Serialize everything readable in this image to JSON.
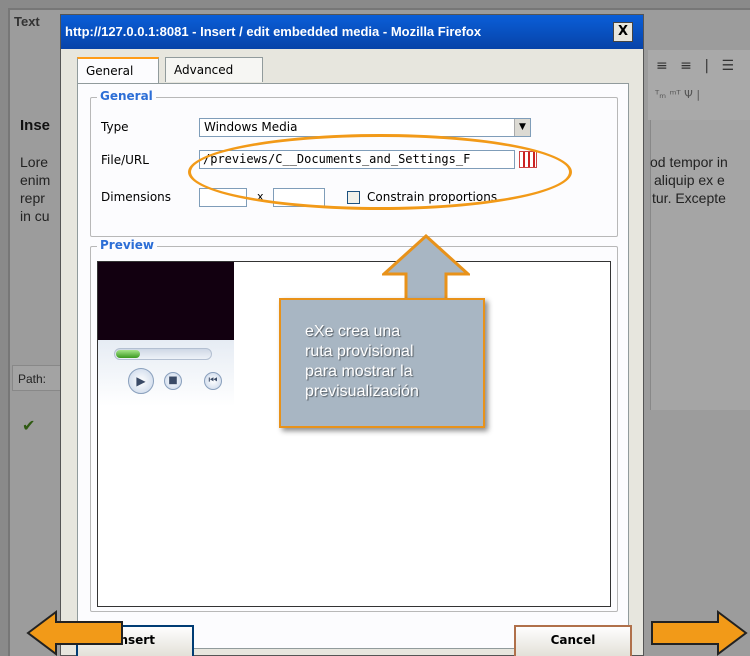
{
  "background_app": {
    "title": "Text",
    "heading": "Inse",
    "left_lines": [
      "Lore",
      "enim",
      "repr",
      "in cu"
    ],
    "right_lines": [
      "od tempor in",
      "aliquip ex e",
      "tur. Excepte"
    ],
    "path_label": "Path:",
    "check_icon": "check-icon"
  },
  "dialog": {
    "title": "http://127.0.0.1:8081 - Insert / edit embedded media - Mozilla Firefox",
    "close_label": "X",
    "tabs": [
      {
        "label": "General",
        "active": true
      },
      {
        "label": "Advanced",
        "active": false
      }
    ],
    "general": {
      "legend": "General",
      "type_label": "Type",
      "type_value": "Windows Media",
      "url_label": "File/URL",
      "url_value": "/previews/C__Documents_and_Settings_F",
      "dimensions_label": "Dimensions",
      "dim_separator": "x",
      "constrain_label": "Constrain proportions"
    },
    "preview": {
      "legend": "Preview"
    },
    "buttons": {
      "insert": "Insert",
      "cancel": "Cancel"
    }
  },
  "annotation": {
    "callout_lines": [
      "eXe crea una",
      "ruta provisional",
      "para mostrar la",
      "previsualización"
    ],
    "accent_color": "#f29a18"
  }
}
